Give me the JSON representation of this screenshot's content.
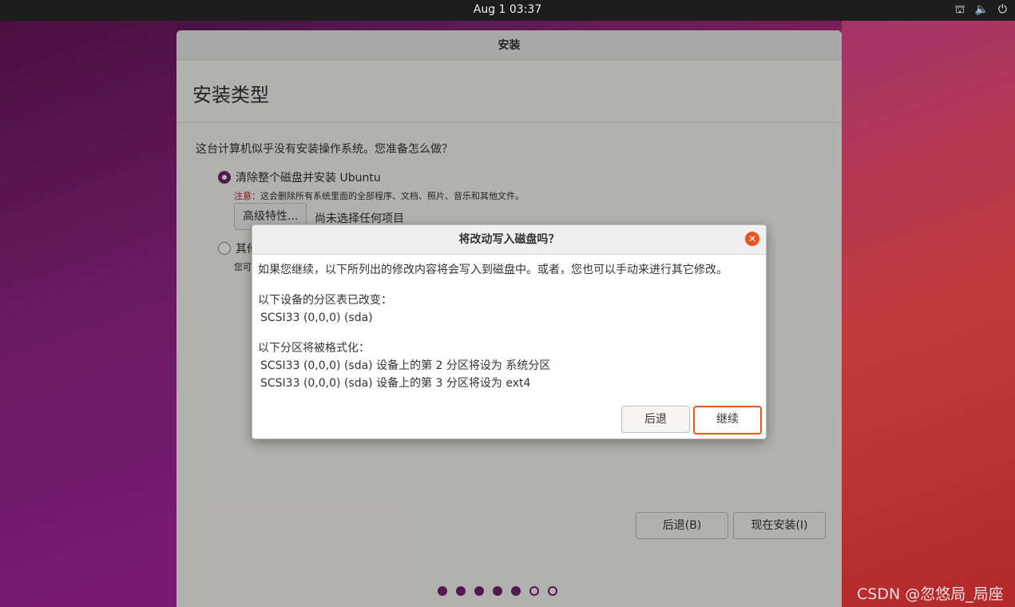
{
  "topbar": {
    "clock": "Aug 1  03:37",
    "icons": [
      "network-icon",
      "volume-icon",
      "power-icon"
    ]
  },
  "window": {
    "title": "安装",
    "heading": "安装类型",
    "question": "这台计算机似乎没有安装操作系统。您准备怎么做？",
    "option1": {
      "label": "清除整个磁盘并安装 Ubuntu",
      "selected": true,
      "warning_label": "注意：",
      "warning_text": "这会删除所有系统里面的全部程序、文档、照片、音乐和其他文件。",
      "advanced_button": "高级特性...",
      "advanced_note": "尚未选择任何项目"
    },
    "option2": {
      "label": "其他",
      "desc": "您可"
    },
    "back_button": "后退(B)",
    "install_button": "现在安装(I)",
    "progress": {
      "total": 7,
      "completed": 5
    }
  },
  "dialog": {
    "title": "将改动写入磁盘吗？",
    "intro": "如果您继续，以下所列出的修改内容将会写入到磁盘中。或者，您也可以手动来进行其它修改。",
    "partition_table_heading": "以下设备的分区表已改变：",
    "partition_table_items": [
      "SCSI33 (0,0,0) (sda)"
    ],
    "format_heading": "以下分区将被格式化：",
    "format_items": [
      "SCSI33 (0,0,0) (sda) 设备上的第 2 分区将设为 系统分区",
      "SCSI33 (0,0,0) (sda) 设备上的第 3 分区将设为 ext4"
    ],
    "back_button": "后退",
    "continue_button": "继续"
  },
  "watermark": "CSDN @忽悠局_局座",
  "colors": {
    "accent": "#e95420",
    "aubergine": "#77216f"
  }
}
